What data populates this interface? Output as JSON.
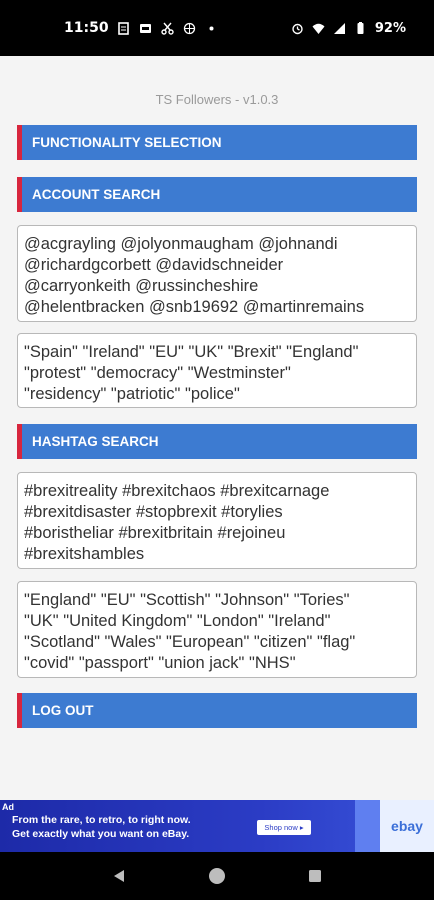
{
  "status_bar": {
    "time": "11:50",
    "battery": "92%",
    "left_icons": [
      "notes-icon",
      "app-icon",
      "scissors-icon",
      "globe-icon",
      "dot-icon"
    ],
    "right_icons": [
      "alarm-icon",
      "wifi-icon",
      "signal-icon",
      "battery-icon"
    ]
  },
  "app": {
    "version_title": "TS Followers - v1.0.3"
  },
  "sections": {
    "functionality_label": "FUNCTIONALITY SELECTION",
    "account_search_label": "ACCOUNT SEARCH",
    "hashtag_search_label": "HASHTAG SEARCH",
    "logout_label": "LOG OUT"
  },
  "account_search": {
    "accounts_value": "@acgrayling @jolyonmaugham @johnandi\n@richardgcorbett @davidschneider\n@carryonkeith @russincheshire\n@helentbracken @snb19692 @martinremains",
    "keywords_value": "\"Spain\" \"Ireland\" \"EU\" \"UK\" \"Brexit\" \"England\"\n\"protest\" \"democracy\" \"Westminster\"\n\"residency\" \"patriotic\" \"police\""
  },
  "hashtag_search": {
    "hashtags_value": "#brexitreality #brexitchaos #brexitcarnage\n#brexitdisaster #stopbrexit #torylies\n#boristheliar #brexitbritain #rejoineu\n#brexitshambles",
    "keywords_value": "\"England\" \"EU\" \"Scottish\" \"Johnson\" \"Tories\"\n\"UK\" \"United Kingdom\" \"London\" \"Ireland\"\n\"Scotland\" \"Wales\" \"European\" \"citizen\" \"flag\"\n\"covid\" \"passport\" \"union jack\" \"NHS\""
  },
  "ad": {
    "tag": "Ad",
    "line1": "From the rare, to retro, to right now.",
    "line2": "Get exactly what you want on eBay.",
    "button": "Shop now ▸",
    "brand": "ebay"
  },
  "colors": {
    "section_bar": "#3d7bd1",
    "section_accent": "#d7263d",
    "background": "#f4f4f4"
  },
  "nav_icons": [
    "back-icon",
    "home-icon",
    "recents-icon"
  ]
}
